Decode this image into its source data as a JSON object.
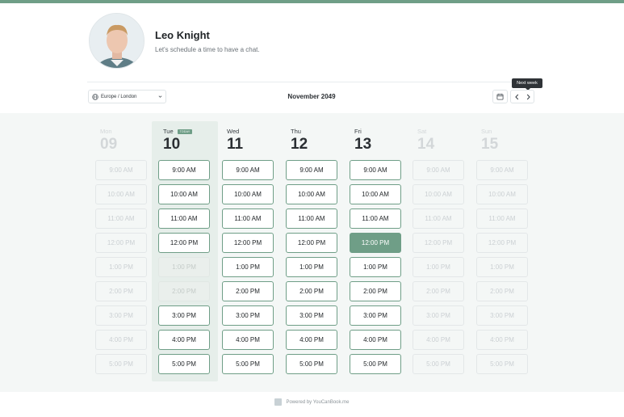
{
  "profile": {
    "name": "Leo Knight",
    "subtitle": "Let's schedule a time to have a chat."
  },
  "controls": {
    "timezone": "Europe / London",
    "month": "November 2049",
    "next_week_tooltip": "Next week"
  },
  "days": [
    {
      "name": "Mon",
      "num": "09",
      "state": "off"
    },
    {
      "name": "Tue",
      "num": "10",
      "state": "today",
      "badge": "TODAY"
    },
    {
      "name": "Wed",
      "num": "11",
      "state": "on"
    },
    {
      "name": "Thu",
      "num": "12",
      "state": "on"
    },
    {
      "name": "Fri",
      "num": "13",
      "state": "on"
    },
    {
      "name": "Sat",
      "num": "14",
      "state": "off"
    },
    {
      "name": "Sun",
      "num": "15",
      "state": "off"
    }
  ],
  "times": [
    "9:00 AM",
    "10:00 AM",
    "11:00 AM",
    "12:00 PM",
    "1:00 PM",
    "2:00 PM",
    "3:00 PM",
    "4:00 PM",
    "5:00 PM"
  ],
  "slot_states": [
    [
      "dis",
      "dis",
      "dis",
      "dis",
      "dis",
      "dis",
      "dis",
      "dis",
      "dis"
    ],
    [
      "avail",
      "avail",
      "avail",
      "avail",
      "booked",
      "booked",
      "avail",
      "avail",
      "avail"
    ],
    [
      "avail",
      "avail",
      "avail",
      "avail",
      "avail",
      "avail",
      "avail",
      "avail",
      "avail"
    ],
    [
      "avail",
      "avail",
      "avail",
      "avail",
      "avail",
      "avail",
      "avail",
      "avail",
      "avail"
    ],
    [
      "avail",
      "avail",
      "avail",
      "selected",
      "avail",
      "avail",
      "avail",
      "avail",
      "avail"
    ],
    [
      "dis",
      "dis",
      "dis",
      "dis",
      "dis",
      "dis",
      "dis",
      "dis",
      "dis"
    ],
    [
      "dis",
      "dis",
      "dis",
      "dis",
      "dis",
      "dis",
      "dis",
      "dis",
      "dis"
    ]
  ],
  "footer": {
    "text": "Powered by YouCanBook.me"
  },
  "colors": {
    "accent": "#6f9e87",
    "today_column": "#e6eeea",
    "grid_background": "#f4f7f6"
  },
  "icons": {
    "timezone": "globe-icon",
    "dropdown": "chevron-down-icon",
    "calendar": "calendar-icon",
    "previous": "chevron-left-icon",
    "next": "chevron-right-icon",
    "footer": "youcanbookme-logo-icon"
  }
}
